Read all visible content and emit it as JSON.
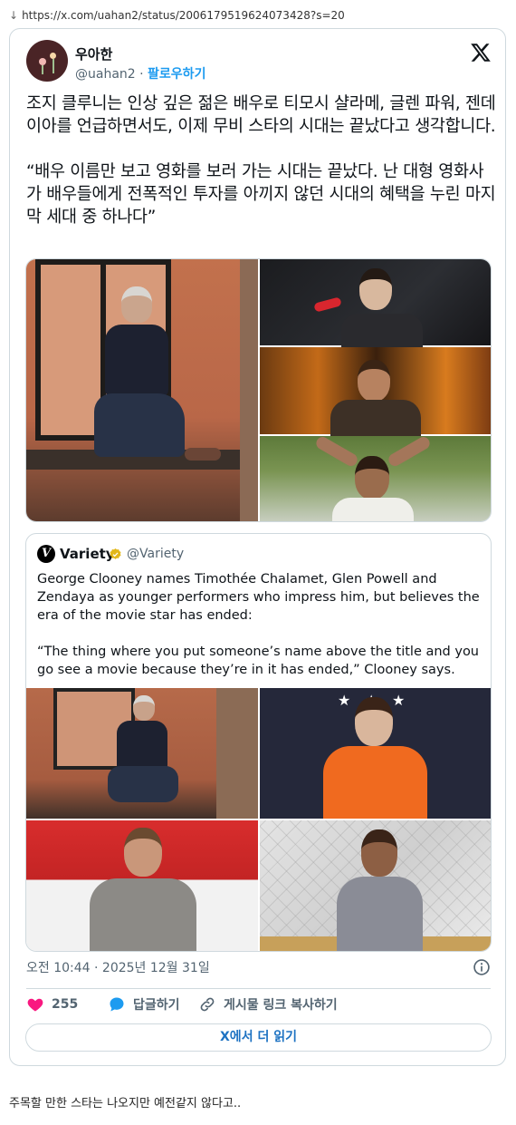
{
  "browser": {
    "url": "https://x.com/uahan2/status/2006179519624073428?s=20",
    "arrow": "↓"
  },
  "tweet": {
    "author_name": "우아한",
    "handle": "@uahan2",
    "separator": " · ",
    "follow_label": "팔로우하기",
    "text_paragraph_1": "조지 클루니는 인상 깊은 젊은 배우로 티모시 샬라메, 글렌 파워, 젠데이아를 언급하면서도, 이제 무비 스타의 시대는 끝났다고 생각합니다.",
    "text_paragraph_2": "“배우 이름만 보고 영화를 보러 가는 시대는 끝났다. 난 대형 영화사가 배우들에게 전폭적인 투자를 아끼지 않던 시대의 혜택을 누린 마지막 세대 중 하나다”",
    "timestamp": "오전 10:44 · 2025년 12월 31일",
    "like_count": "255",
    "reply_label": "답글하기",
    "copy_link_label": "게시물 링크 복사하기",
    "read_more_label": "X에서 더 읽기"
  },
  "quote": {
    "logo_letter": "V",
    "name": "Variety",
    "handle": "@Variety",
    "text_paragraph_1": "George Clooney names Timothée Chalamet, Glen Powell and Zendaya as younger performers who impress him, but believes the era of the movie star has ended:",
    "text_paragraph_2": "“The thing where you put someone’s name above the title and you go see a movie because they’re in it has ended,” Clooney says."
  },
  "caption": "주목할 만한 스타는 나오지만 예전같지 않다고..",
  "colors": {
    "accent_blue": "#1d9bf0",
    "like_pink": "#f91880",
    "reply_blue": "#1d9bf0",
    "verified_gold": "#e2b719",
    "text_secondary": "#536471",
    "border": "#cfd9de"
  },
  "icons": [
    "x-logo-icon",
    "verified-badge-icon",
    "info-icon",
    "heart-icon",
    "reply-bubble-icon",
    "link-icon"
  ]
}
